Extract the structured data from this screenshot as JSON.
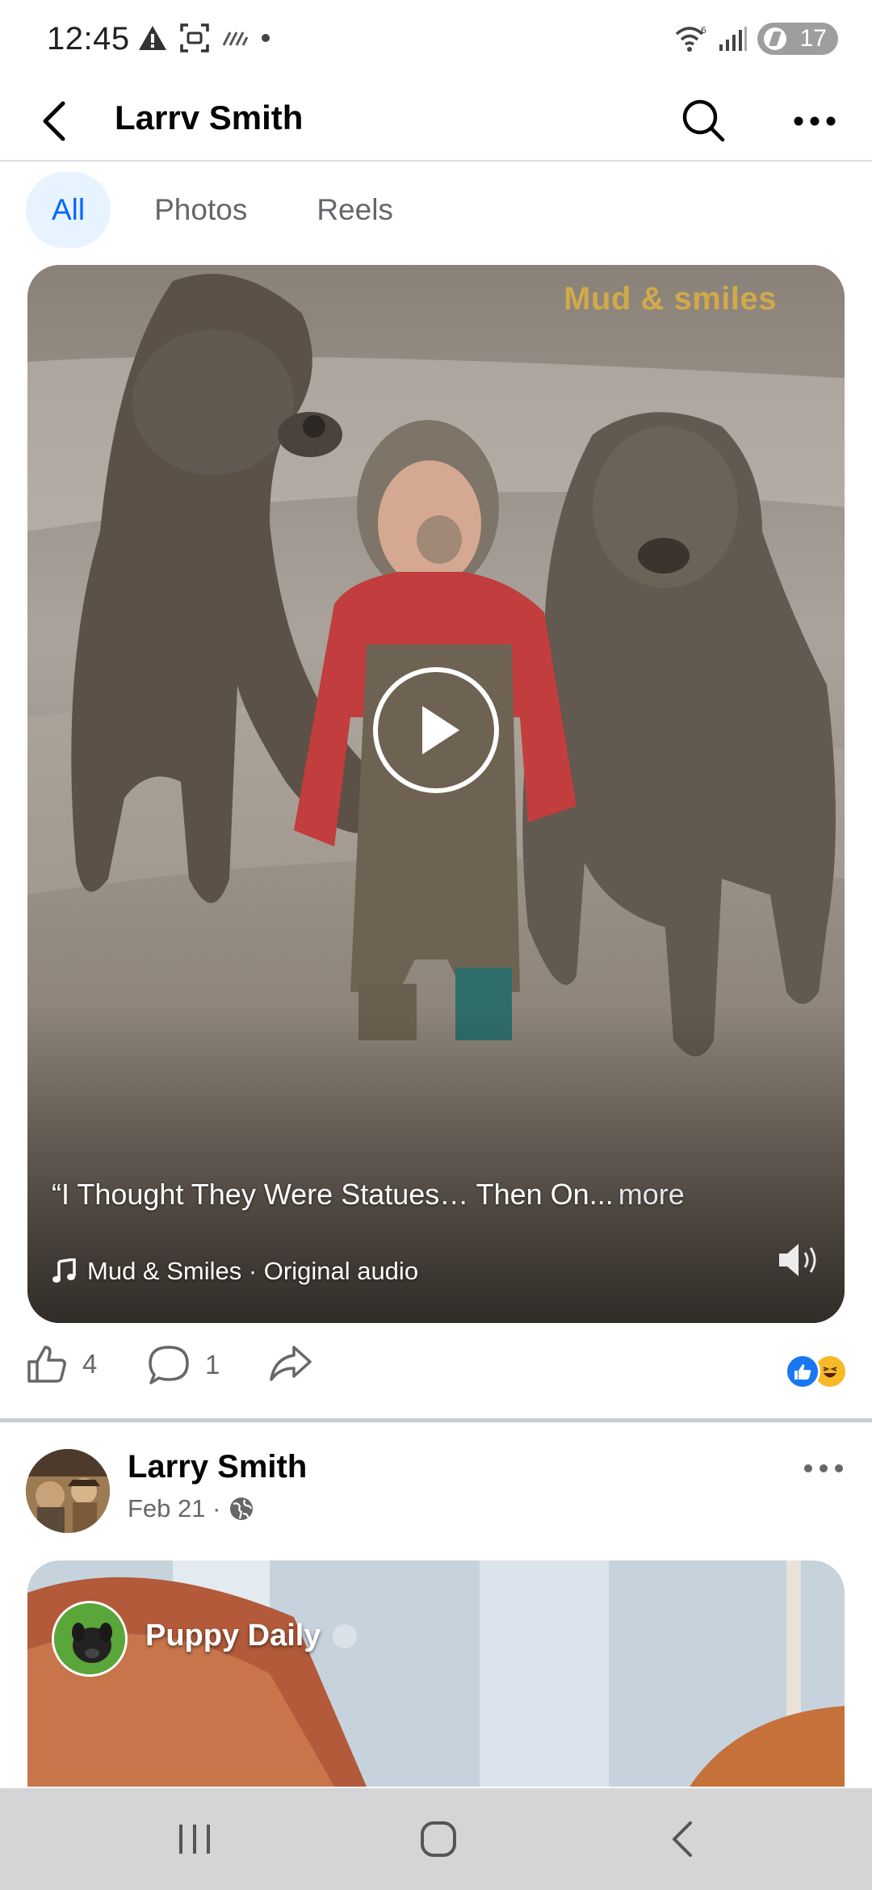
{
  "status_bar": {
    "time": "12:45",
    "battery_level": "17",
    "icons_left": [
      "alert-icon",
      "screenshot-icon",
      "signal-lines-icon",
      "dot-icon"
    ],
    "icons_right": [
      "wifi-icon",
      "cell-signal-icon",
      "battery-icon"
    ]
  },
  "header": {
    "title": "Larrv Smith",
    "back_icon": "chevron-left-icon",
    "search_icon": "search-icon",
    "more_icon": "more-horizontal-icon"
  },
  "tabs": [
    {
      "label": "All",
      "active": true
    },
    {
      "label": "Photos",
      "active": false
    },
    {
      "label": "Reels",
      "active": false
    }
  ],
  "video": {
    "watermark": "Mud & smiles",
    "caption": "“I Thought They Were Statues… Then On...",
    "more_label": "more",
    "audio": "Mud & Smiles · Original audio"
  },
  "actions": {
    "like_count": "4",
    "comment_count": "1",
    "reactions": [
      "like-reaction",
      "haha-reaction"
    ]
  },
  "post": {
    "author": "Larry Smith",
    "date": "Feb 21 ·",
    "audience_icon": "globe-icon",
    "preview_channel": "Puppy Daily"
  },
  "colors": {
    "accent": "#0866ff",
    "tab_active_bg": "#e7f3ff",
    "secondary_text": "#65676b",
    "like_blue": "#1877f2",
    "haha_yellow": "#f7b928",
    "watermark_gold": "#d9ad46"
  }
}
